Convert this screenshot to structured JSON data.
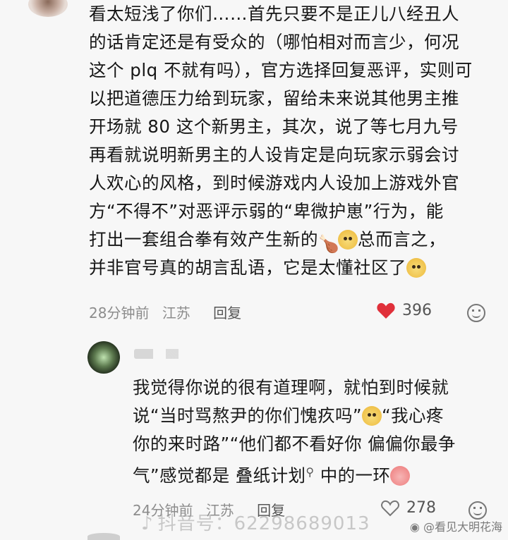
{
  "comment1": {
    "lines": [
      "看太短浅了你们……首先只要不是正儿八经丑人",
      "的话肯定还是有受众的（哪怕相对而言少，何况",
      "这个 plq 不就有吗），官方选择回复恶评，实则可",
      "以把道德压力给到玩家，留给未来说其他男主推",
      "开场就 80 这个新男主，其次，说了等七月九号",
      "再看就说明新男主的人设肯定是向玩家示弱会讨",
      "人欢心的风格，到时候游戏内人设加上游戏外官",
      "方“不得不”对恶评示弱的“卑微护崽”行为，能",
      "打出一套组合拳有效产生新的",
      "总而言之，",
      "并非官号真的胡言乱语，它是太懂社区了"
    ],
    "time": "28分钟前",
    "location": "江苏",
    "reply_label": "回复",
    "likes": "396"
  },
  "comment2": {
    "lines": [
      "我觉得你说的很有道理啊，就怕到时候就",
      "说“当时骂熬尹的你们愧疚吗”",
      "“我心疼",
      "你的来时路”“他们都不看好你 偏偏你最争",
      "气”感觉都是 ",
      "叠纸计划",
      " 中的一环"
    ],
    "time": "24分钟前",
    "location": "江苏",
    "reply_label": "回复",
    "likes": "278"
  },
  "watermark": {
    "text": "抖音号：62298689013",
    "weibo": "@看见大明花海"
  },
  "icons": {
    "heart_color": "#e0303a",
    "emoji_face": "dog-face-emoji",
    "emoji_drumstick": "drumstick-emoji",
    "emoji_crying": "crying-face-emoji"
  }
}
